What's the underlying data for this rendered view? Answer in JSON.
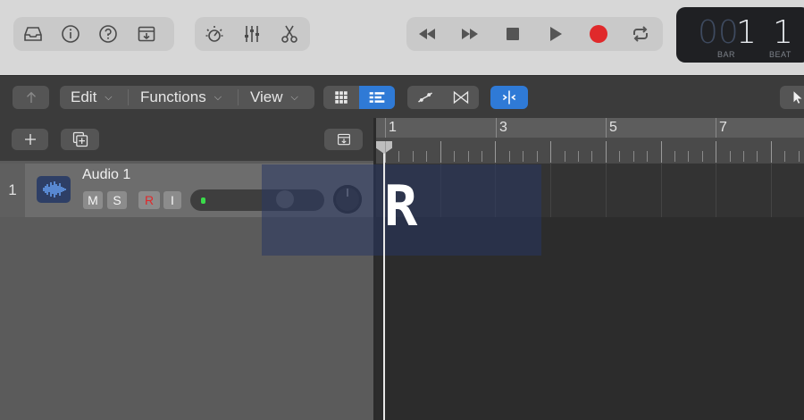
{
  "lcd": {
    "bar_value": "1",
    "beat_value": "1",
    "bar_ghost": "00",
    "bar_caption": "BAR",
    "beat_caption": "BEAT"
  },
  "menus": {
    "edit": "Edit",
    "functions": "Functions",
    "view": "View"
  },
  "ruler": {
    "bars": [
      "1",
      "3",
      "5",
      "7"
    ]
  },
  "track": {
    "number": "1",
    "name": "Audio 1",
    "mute": "M",
    "solo": "S",
    "record": "R",
    "input_monitor": "I"
  },
  "key_overlay": {
    "key": "R"
  },
  "colors": {
    "record_red": "#e0292b",
    "level_green": "#3adc4a",
    "accent_blue": "#2f7ad6"
  }
}
